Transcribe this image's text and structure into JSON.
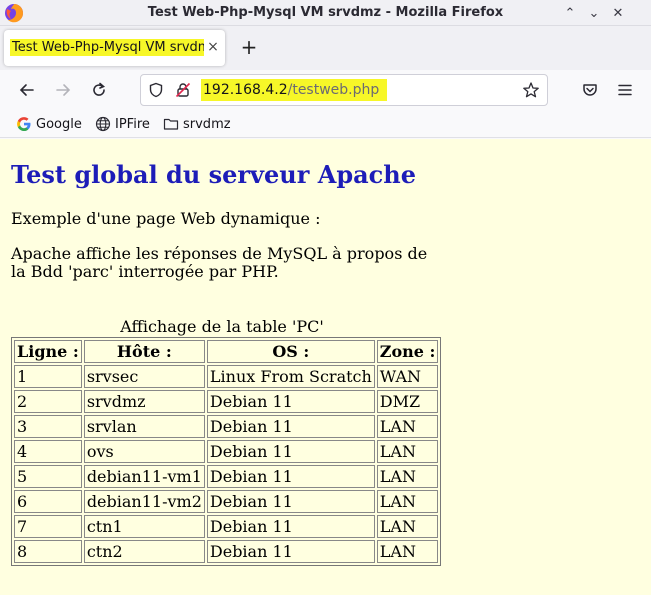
{
  "window": {
    "title": "Test Web-Php-Mysql VM srvdmz - Mozilla Firefox",
    "controls": {
      "minimize": "⌃",
      "maximize": "⌄",
      "close": "✕"
    }
  },
  "tab": {
    "label": "Test Web-Php-Mysql VM srvdmz",
    "close": "×",
    "new_tab": "+"
  },
  "urlbar": {
    "host": "192.168.4.2",
    "path": "/testweb.php"
  },
  "bookmarks": [
    {
      "label": "Google",
      "icon": "google-icon"
    },
    {
      "label": "IPFire",
      "icon": "globe-icon"
    },
    {
      "label": "srvdmz",
      "icon": "folder-icon"
    }
  ],
  "page": {
    "title": "Test global du serveur Apache",
    "para1": "Exemple d'une page Web dynamique :",
    "para2": "Apache affiche les réponses de MySQL à propos de la Bdd 'parc' interrogée par PHP.",
    "caption": "Affichage de la table 'PC'",
    "table": {
      "headers": [
        "Ligne :",
        "Hôte :",
        "OS :",
        "Zone :"
      ],
      "rows": [
        [
          "1",
          "srvsec",
          "Linux From Scratch",
          "WAN"
        ],
        [
          "2",
          "srvdmz",
          "Debian 11",
          "DMZ"
        ],
        [
          "3",
          "srvlan",
          "Debian 11",
          "LAN"
        ],
        [
          "4",
          "ovs",
          "Debian 11",
          "LAN"
        ],
        [
          "5",
          "debian11-vm1",
          "Debian 11",
          "LAN"
        ],
        [
          "6",
          "debian11-vm2",
          "Debian 11",
          "LAN"
        ],
        [
          "7",
          "ctn1",
          "Debian 11",
          "LAN"
        ],
        [
          "8",
          "ctn2",
          "Debian 11",
          "LAN"
        ]
      ]
    }
  },
  "colors": {
    "page_background": "#ffffe0",
    "title_color": "#1d1db8",
    "highlight": "#f7f728"
  }
}
